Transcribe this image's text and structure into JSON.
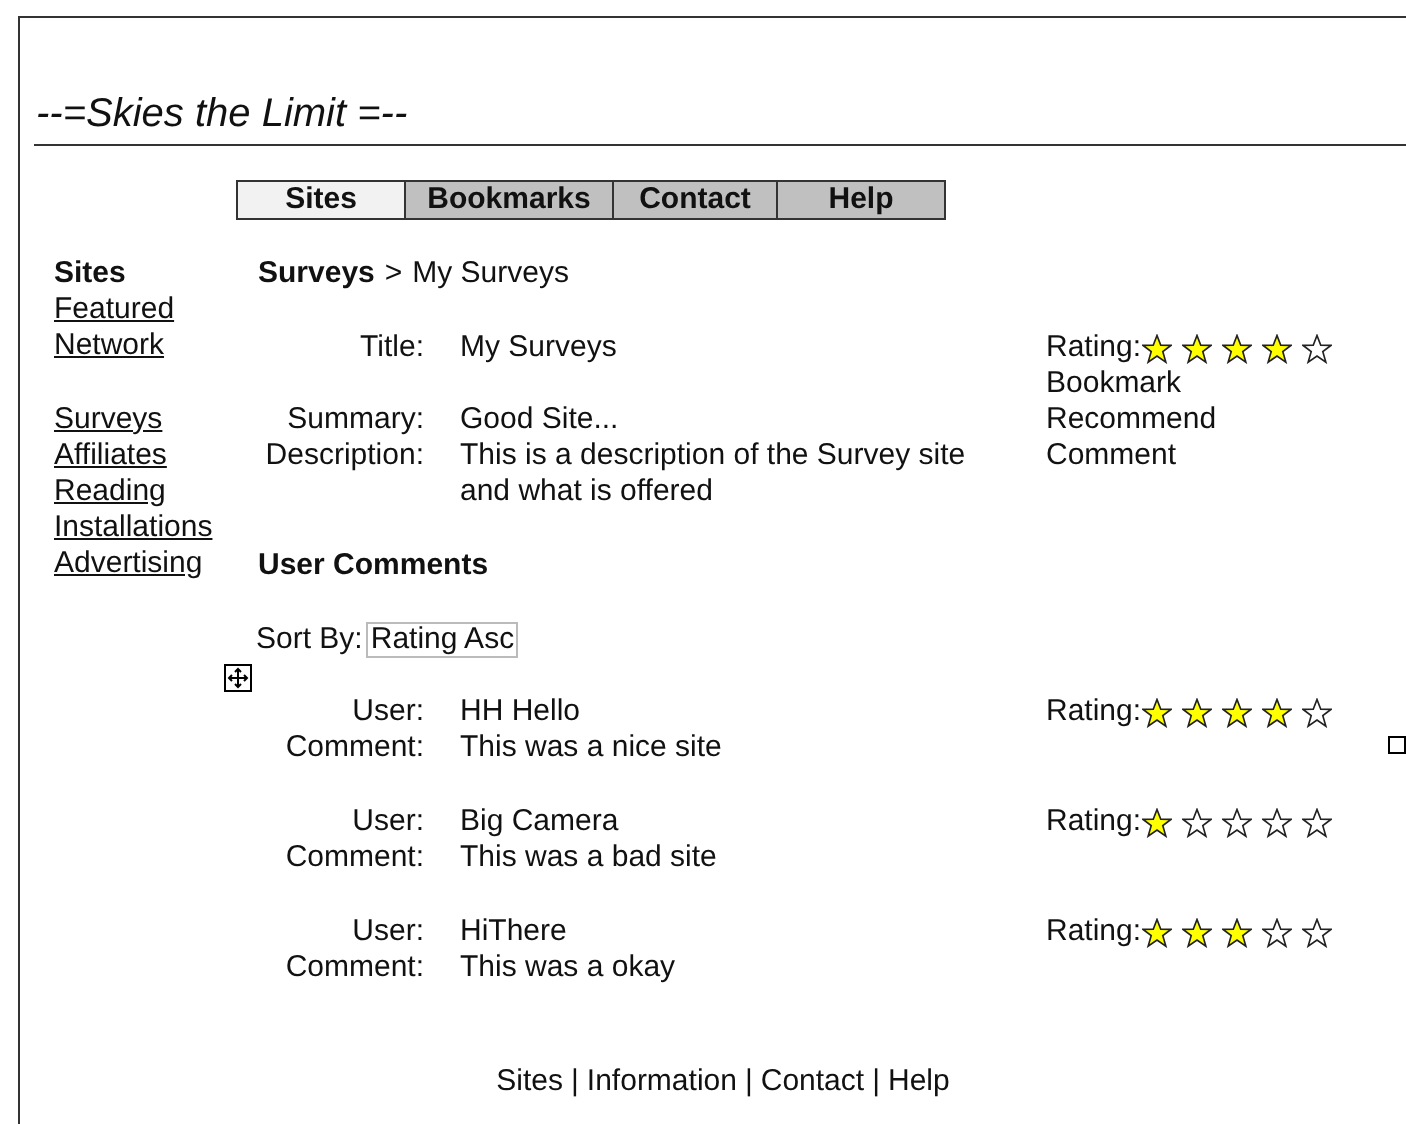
{
  "site_title": "--=Skies the Limit =--",
  "nav_tabs": [
    {
      "label": "Sites",
      "selected": true
    },
    {
      "label": "Bookmarks",
      "selected": false
    },
    {
      "label": "Contact",
      "selected": false
    },
    {
      "label": "Help",
      "selected": false
    }
  ],
  "sidebar": {
    "heading": "Sites",
    "groups": [
      [
        "Featured",
        "Network"
      ],
      [
        "Surveys",
        "Affiliates",
        "Reading",
        "Installations",
        "Advertising"
      ]
    ]
  },
  "breadcrumb": {
    "parent": "Surveys",
    "separator": ">",
    "current": "My Surveys"
  },
  "details": {
    "fields": [
      {
        "label": "Title:",
        "value": "My Surveys"
      },
      {
        "label": "Summary:",
        "value": "Good Site..."
      },
      {
        "label": "Description:",
        "value": "This is a description of the Survey site and what is offered"
      }
    ],
    "rating_label": "Rating:",
    "stars": 4,
    "actions": [
      "Bookmark",
      "Recommend",
      "Comment"
    ]
  },
  "comments_heading": "User Comments",
  "sort": {
    "label": "Sort By:",
    "value": "Rating Asc"
  },
  "comments": [
    {
      "user_label": "User:",
      "user": "HH Hello",
      "comment_label": "Comment:",
      "comment": "This was a nice site",
      "rating_label": "Rating:",
      "stars": 4
    },
    {
      "user_label": "User:",
      "user": "Big Camera",
      "comment_label": "Comment:",
      "comment": "This was a bad site",
      "rating_label": "Rating:",
      "stars": 1
    },
    {
      "user_label": "User:",
      "user": "HiThere",
      "comment_label": "Comment:",
      "comment": "This was a okay",
      "rating_label": "Rating:",
      "stars": 3
    }
  ],
  "footer": {
    "links": [
      "Sites",
      "Information",
      "Contact",
      "Help"
    ],
    "separator": "|"
  }
}
